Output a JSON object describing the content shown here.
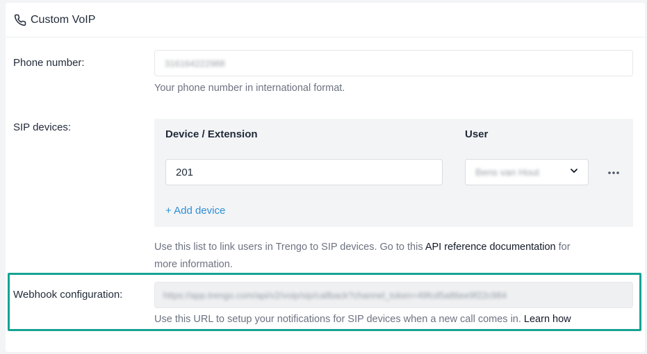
{
  "header": {
    "title": "Custom VoIP",
    "icon": "phone-icon"
  },
  "phone": {
    "label": "Phone number:",
    "value": "316164222988",
    "help": "Your phone number in international format."
  },
  "sip": {
    "label": "SIP devices:",
    "columns": [
      "Device / Extension",
      "User"
    ],
    "rows": [
      {
        "extension": "201",
        "user": "Bens van Hout"
      }
    ],
    "add_label": "+ Add device",
    "help_prefix": "Use this list to link users in Trengo to SIP devices. Go to this ",
    "help_link": "API reference documentation",
    "help_suffix": " for more information."
  },
  "webhook": {
    "label": "Webhook configuration:",
    "value": "https://app.trengo.com/api/v2/voip/sip/callback?channel_token=49fcd5a86ee9f22c984",
    "help_prefix": "Use this URL to setup your notifications for SIP devices when a new call comes in. ",
    "help_link": "Learn how",
    "highlight_color": "#16a392"
  },
  "colors": {
    "accent_link": "#2e8fd6",
    "panel_bg": "#f3f4f6"
  }
}
